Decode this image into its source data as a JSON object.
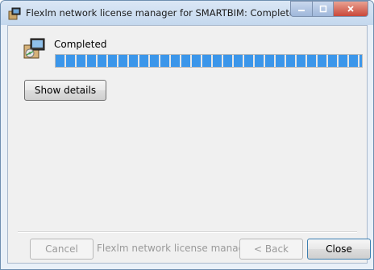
{
  "window": {
    "title": "Flexlm network license manager for SMARTBIM: Completed",
    "caption": {
      "minimize_icon": "minimize-icon",
      "maximize_icon": "maximize-icon",
      "close_icon": "close-icon"
    }
  },
  "status": {
    "text": "Completed",
    "progress_fraction": 1.0,
    "progress_color": "#3b96ea",
    "icon": "installer-package-icon"
  },
  "buttons": {
    "show_details": "Show details",
    "cancel": "Cancel",
    "back": "< Back",
    "close": "Close"
  },
  "footer": {
    "brand": "Flexlm network license manager"
  }
}
